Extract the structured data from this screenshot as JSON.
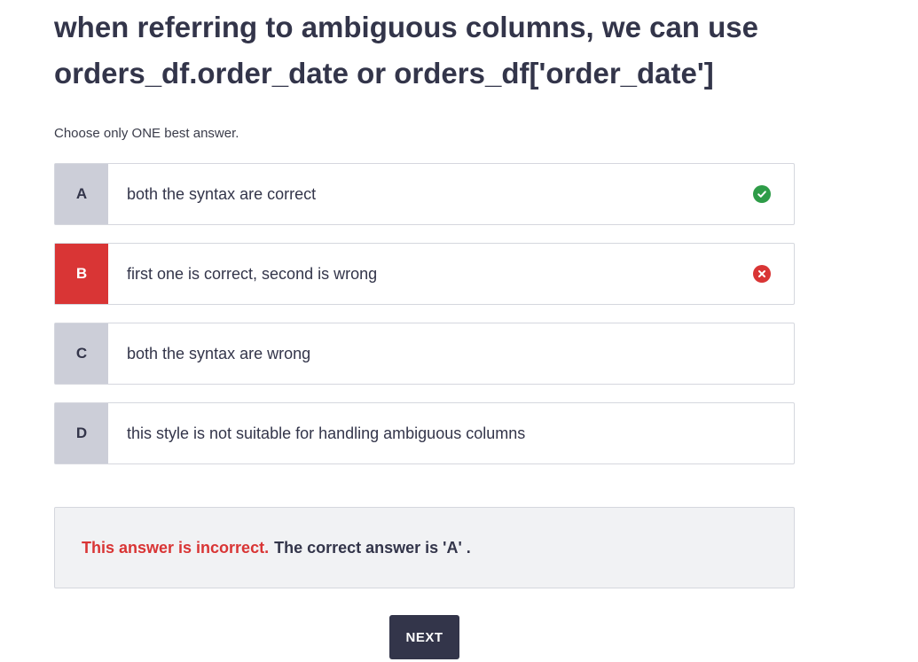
{
  "question": {
    "text": "when referring to ambiguous columns, we can use orders_df.order_date or orders_df['order_date']"
  },
  "instruction": "Choose only ONE best answer.",
  "options": [
    {
      "letter": "A",
      "text": "both the syntax are correct",
      "status": "correct",
      "status_icon": "check-circle-icon"
    },
    {
      "letter": "B",
      "text": "first one is correct, second is wrong",
      "status": "selected-wrong",
      "status_icon": "x-circle-icon"
    },
    {
      "letter": "C",
      "text": "both the syntax are wrong",
      "status": "none"
    },
    {
      "letter": "D",
      "text": "this style is not suitable for handling ambiguous columns",
      "status": "none"
    }
  ],
  "feedback": {
    "incorrect_text": "This answer is incorrect.",
    "correct_text": "The correct answer is 'A' ."
  },
  "next_button": {
    "label": "NEXT"
  },
  "colors": {
    "wrong": "#d93535",
    "correct": "#2e9c48",
    "dark": "#33354a",
    "letter_bg": "#ccced8"
  }
}
